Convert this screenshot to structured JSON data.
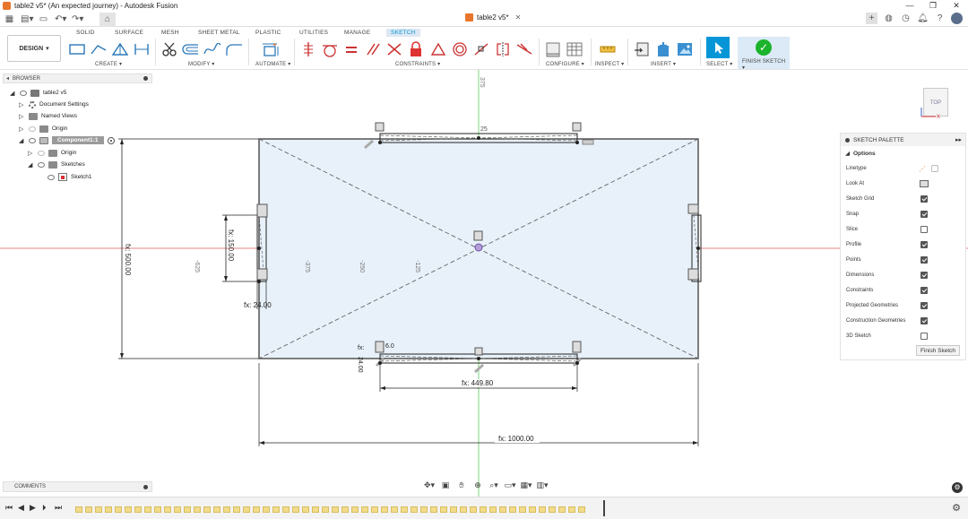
{
  "window": {
    "title": "table2 v5* (An expected journey) - Autodesk Fusion",
    "min": "—",
    "restore": "❐",
    "close": "✕"
  },
  "document_tab": {
    "name": "table2 v5*",
    "close": "✕"
  },
  "toolbar": {
    "tabs": [
      "SOLID",
      "SURFACE",
      "MESH",
      "SHEET METAL",
      "PLASTIC",
      "UTILITIES",
      "MANAGE",
      "SKETCH"
    ],
    "active_tab": "SKETCH",
    "workspace": "DESIGN",
    "groups": {
      "create": "CREATE ▾",
      "modify": "MODIFY ▾",
      "automate": "AUTOMATE ▾",
      "constraints": "CONSTRAINTS ▾",
      "configure": "CONFIGURE ▾",
      "inspect": "INSPECT ▾",
      "insert": "INSERT ▾",
      "select": "SELECT ▾",
      "finish_sketch": "FINISH SKETCH ▾"
    }
  },
  "browser": {
    "header": "BROWSER",
    "nodes": {
      "root": "table2 v5",
      "document_settings": "Document Settings",
      "named_views": "Named Views",
      "origin": "Origin",
      "component": "Component1:1",
      "component_origin": "Origin",
      "sketches": "Sketches",
      "sketch1": "Sketch1"
    }
  },
  "palette": {
    "header": "SKETCH PALETTE",
    "section": "Options",
    "options": [
      {
        "label": "Linetype"
      },
      {
        "label": "Look At"
      },
      {
        "label": "Sketch Grid",
        "checked": true
      },
      {
        "label": "Snap",
        "checked": true
      },
      {
        "label": "Slice",
        "checked": false
      },
      {
        "label": "Profile",
        "checked": true
      },
      {
        "label": "Points",
        "checked": true
      },
      {
        "label": "Dimensions",
        "checked": true
      },
      {
        "label": "Constraints",
        "checked": true
      },
      {
        "label": "Projected Geometries",
        "checked": true
      },
      {
        "label": "Construction Geometries",
        "checked": true
      },
      {
        "label": "3D Sketch",
        "checked": false
      }
    ],
    "finish_button": "Finish Sketch"
  },
  "viewcube": {
    "face": "TOP"
  },
  "sketch": {
    "dims": {
      "width": "fx: 1000.00",
      "height": "fx: 500.00",
      "slot_len": "fx: 449.80",
      "side_len": "fx: 150.00",
      "side_w": "fx: 24.00",
      "bottom_small_a": "fx:",
      "bottom_small_b": "24.00",
      "bottom_small_c": "6.0",
      "top_num": "25"
    },
    "ruler": {
      "y_top": "375",
      "y_mid": "125",
      "x1": "-625",
      "x2": "-375",
      "x3": "-250",
      "x4": "-125"
    }
  },
  "comments": {
    "header": "COMMENTS"
  },
  "colors": {
    "accent": "#0696d7",
    "profile": "#e8f1f9",
    "finish": "#1bb32b",
    "axis_red": "#e05a5a",
    "axis_green": "#5ac85a"
  }
}
